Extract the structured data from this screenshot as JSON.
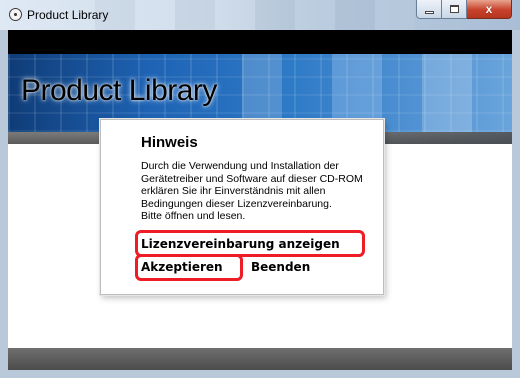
{
  "window": {
    "title": "Product Library",
    "controls": {
      "minimize_icon": "minimize-icon",
      "maximize_icon": "maximize-icon",
      "close_icon": "close-icon",
      "close_glyph": "x"
    }
  },
  "banner": {
    "title": "Product Library"
  },
  "dialog": {
    "heading": "Hinweis",
    "body_lines": [
      "Durch die Verwendung und Installation der",
      "Gerätetreiber und Software auf dieser CD-ROM",
      "erklären Sie ihr Einverständnis mit allen",
      "Bedingungen dieser Lizenzvereinbarung.",
      "Bitte öffnen und lesen."
    ],
    "license_link": "Lizenzvereinbarung anzeigen",
    "accept_link": "Akzeptieren",
    "exit_link": "Beenden"
  },
  "colors": {
    "highlight": "#ee1c25",
    "banner": "#1e63b4",
    "close_button": "#c8412a"
  }
}
